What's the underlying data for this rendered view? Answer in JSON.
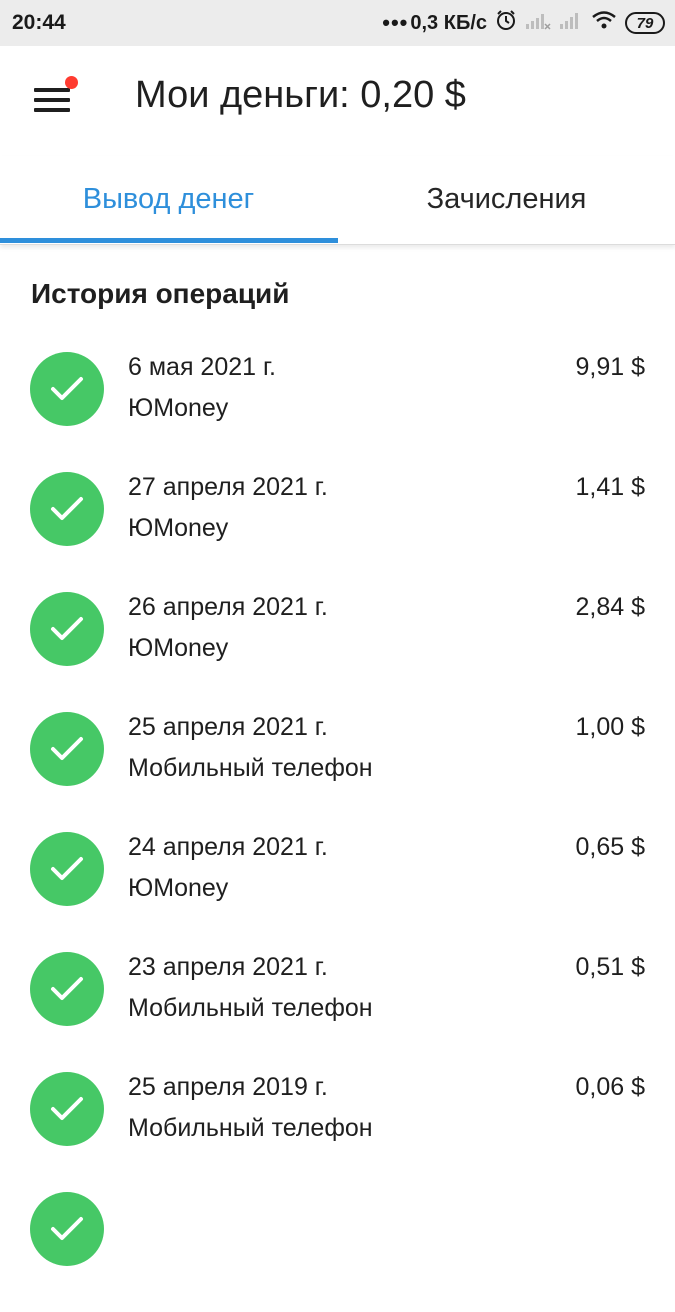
{
  "status_bar": {
    "time": "20:44",
    "net_speed": "0,3 КБ/с",
    "battery": "79"
  },
  "header": {
    "title": "Мои деньги: 0,20 $"
  },
  "tabs": [
    {
      "label": "Вывод денег",
      "active": true
    },
    {
      "label": "Зачисления",
      "active": false
    }
  ],
  "history": {
    "title": "История операций",
    "items": [
      {
        "date": "6 мая 2021 г.",
        "desc": "ЮMoney",
        "amount": "9,91 $"
      },
      {
        "date": "27 апреля 2021 г.",
        "desc": "ЮMoney",
        "amount": "1,41 $"
      },
      {
        "date": "26 апреля 2021 г.",
        "desc": "ЮMoney",
        "amount": "2,84 $"
      },
      {
        "date": "25 апреля 2021 г.",
        "desc": "Мобильный телефон",
        "amount": "1,00 $"
      },
      {
        "date": "24 апреля 2021 г.",
        "desc": "ЮMoney",
        "amount": "0,65 $"
      },
      {
        "date": "23 апреля 2021 г.",
        "desc": "Мобильный телефон",
        "amount": "0,51 $"
      },
      {
        "date": "25 апреля 2019 г.",
        "desc": "Мобильный телефон",
        "amount": "0,06 $"
      },
      {
        "date": "",
        "desc": "",
        "amount": ""
      }
    ]
  },
  "colors": {
    "accent": "#2e8fdb",
    "success": "#46c866",
    "notification_dot": "#ff3b30",
    "status_bar_bg": "#ececec"
  },
  "icons": [
    "menu-icon",
    "notification-dot",
    "alarm-icon",
    "signal-icon",
    "wifi-icon",
    "battery-icon",
    "check-icon"
  ]
}
